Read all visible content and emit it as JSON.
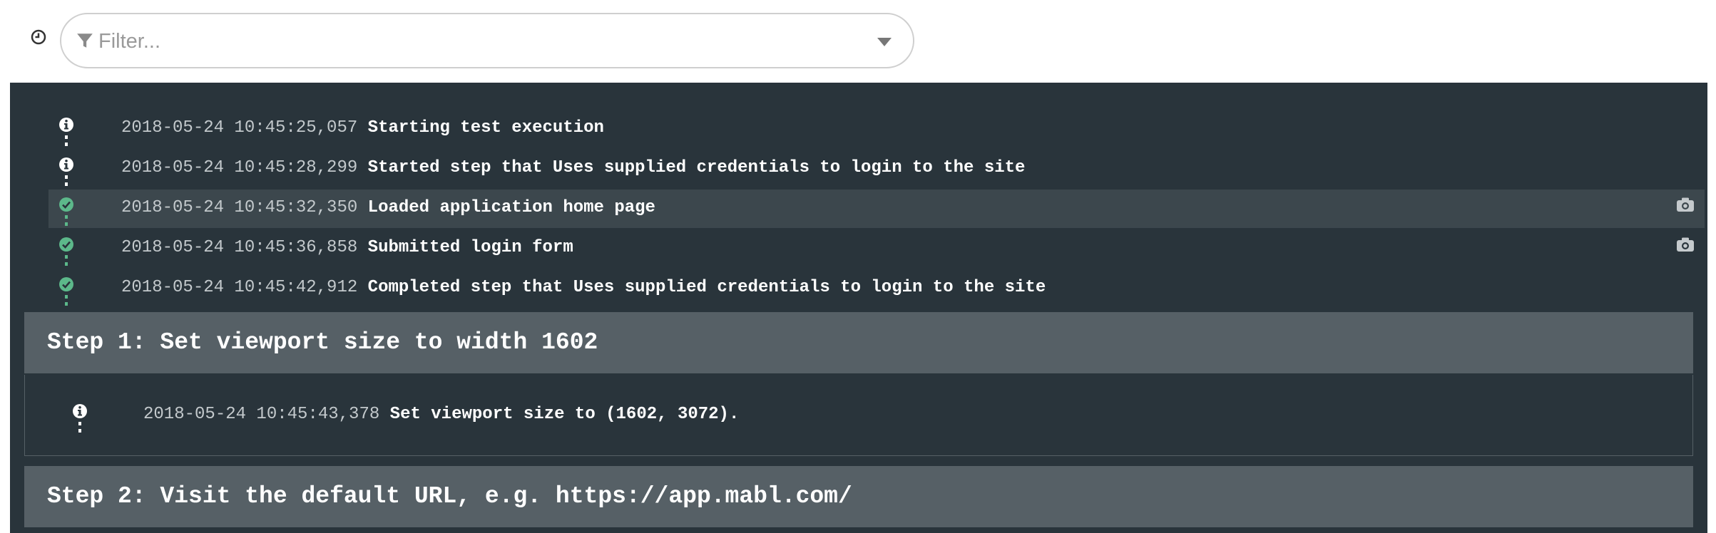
{
  "filter": {
    "placeholder": "Filter..."
  },
  "colors": {
    "info": "#ffffff",
    "success": "#5cb88a",
    "panel": "#29343b",
    "step_header": "#566066"
  },
  "log": [
    {
      "time": "2018-05-24 10:45:25,057",
      "message": "Starting test execution",
      "status": "info",
      "screenshot": false
    },
    {
      "time": "2018-05-24 10:45:28,299",
      "message": "Started step that Uses supplied credentials to login to the site",
      "status": "info",
      "screenshot": false
    },
    {
      "time": "2018-05-24 10:45:32,350",
      "message": "Loaded application home page",
      "status": "success",
      "screenshot": true
    },
    {
      "time": "2018-05-24 10:45:36,858",
      "message": "Submitted login form",
      "status": "success",
      "screenshot": true
    },
    {
      "time": "2018-05-24 10:45:42,912",
      "message": "Completed step that Uses supplied credentials to login to the site",
      "status": "success",
      "screenshot": false
    }
  ],
  "steps": [
    {
      "title": "Step 1: Set viewport size to width 1602",
      "entries": [
        {
          "time": "2018-05-24 10:45:43,378",
          "message": "Set viewport size to (1602, 3072).",
          "status": "info"
        }
      ]
    },
    {
      "title": "Step 2: Visit the default URL, e.g. https://app.mabl.com/"
    }
  ]
}
